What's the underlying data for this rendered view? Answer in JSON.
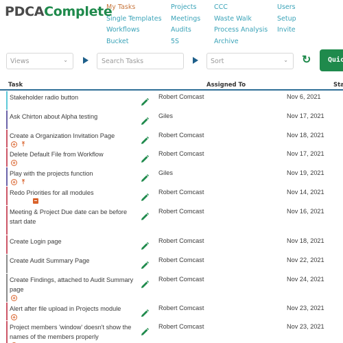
{
  "brand": {
    "part1": "PDCA",
    "part2": "Complete"
  },
  "nav": {
    "col1": [
      "My Tasks",
      "Single Templates",
      "Workflows",
      "Bucket"
    ],
    "col2": [
      "Projects",
      "Meetings",
      "Audits",
      "5S"
    ],
    "col3": [
      "CCC",
      "Waste Walk",
      "Process Analysis",
      "Archive"
    ],
    "col4": [
      "Users",
      "Setup",
      "Invite"
    ],
    "active": "My Tasks"
  },
  "toolbar": {
    "views_placeholder": "Views",
    "search_placeholder": "Search Tasks",
    "sort_placeholder": "Sort",
    "quick_button": "Quick",
    "icons": {
      "go": "play-icon",
      "refresh": "refresh-icon",
      "dropdown": "chevron-down-icon"
    }
  },
  "colors": {
    "brand_green": "#1f8a4c",
    "brand_gray": "#4a4a4a",
    "nav_link": "#3aa3b8",
    "nav_active": "#c8773f",
    "header_rule": "#2e6e96",
    "priority_cyan": "#5bc8d8",
    "priority_purple": "#6a62a8",
    "priority_red": "#cc5566",
    "priority_gray": "#8a8a8a",
    "icon_orange": "#d9622b"
  },
  "table": {
    "columns": [
      "Task",
      "Assigned To",
      "Sta"
    ],
    "rows": [
      {
        "task": "Stakeholder radio button",
        "assigned": "Robert Comcast",
        "date": "Nov 6, 2021",
        "priority": "cyan",
        "icons": []
      },
      {
        "task": "Ask Chirton about Alpha testing",
        "assigned": "Giles",
        "date": "Nov 17, 2021",
        "priority": "purple",
        "icons": []
      },
      {
        "task": "Create a Organization Invitation Page",
        "assigned": "Robert Comcast",
        "date": "Nov 18, 2021",
        "priority": "red",
        "icons": [
          "plus-circle-icon",
          "upload-icon"
        ]
      },
      {
        "task": "Delete Default File from Workflow",
        "assigned": "Robert Comcast",
        "date": "Nov 17, 2021",
        "priority": "red",
        "icons": [
          "plus-circle-icon"
        ]
      },
      {
        "task": "Play with the projects function",
        "assigned": "Giles",
        "date": "Nov 19, 2021",
        "priority": "purple",
        "icons": [
          "plus-circle-icon",
          "upload-icon"
        ]
      },
      {
        "task": "Redo Priorities for all modules",
        "assigned": "Robert Comcast",
        "date": "Nov 14, 2021",
        "priority": "red",
        "icons": [
          "calendar-icon"
        ]
      },
      {
        "task": "Meeting & Project Due date can be before start date",
        "assigned": "Robert Comcast",
        "date": "Nov 16, 2021",
        "priority": "red",
        "icons": []
      },
      {
        "task": "Create Login page",
        "assigned": "Robert Comcast",
        "date": "Nov 18, 2021",
        "priority": "red",
        "icons": []
      },
      {
        "task": "Create Audit Summary Page",
        "assigned": "Robert Comcast",
        "date": "Nov 22, 2021",
        "priority": "gray",
        "icons": []
      },
      {
        "task": "Create Findings, attached to Audit Summary page",
        "assigned": "Robert Comcast",
        "date": "Nov 24, 2021",
        "priority": "gray",
        "icons": [
          "plus-circle-icon"
        ]
      },
      {
        "task": "Alert after file upload in Projects module",
        "assigned": "Robert Comcast",
        "date": "Nov 23, 2021",
        "priority": "red",
        "icons": [
          "plus-circle-icon"
        ]
      },
      {
        "task": "Project members 'window' doesn't show the names of the members properly",
        "assigned": "Robert Comcast",
        "date": "Nov 23, 2021",
        "priority": "red",
        "icons": [
          "plus-circle-icon"
        ]
      }
    ]
  }
}
